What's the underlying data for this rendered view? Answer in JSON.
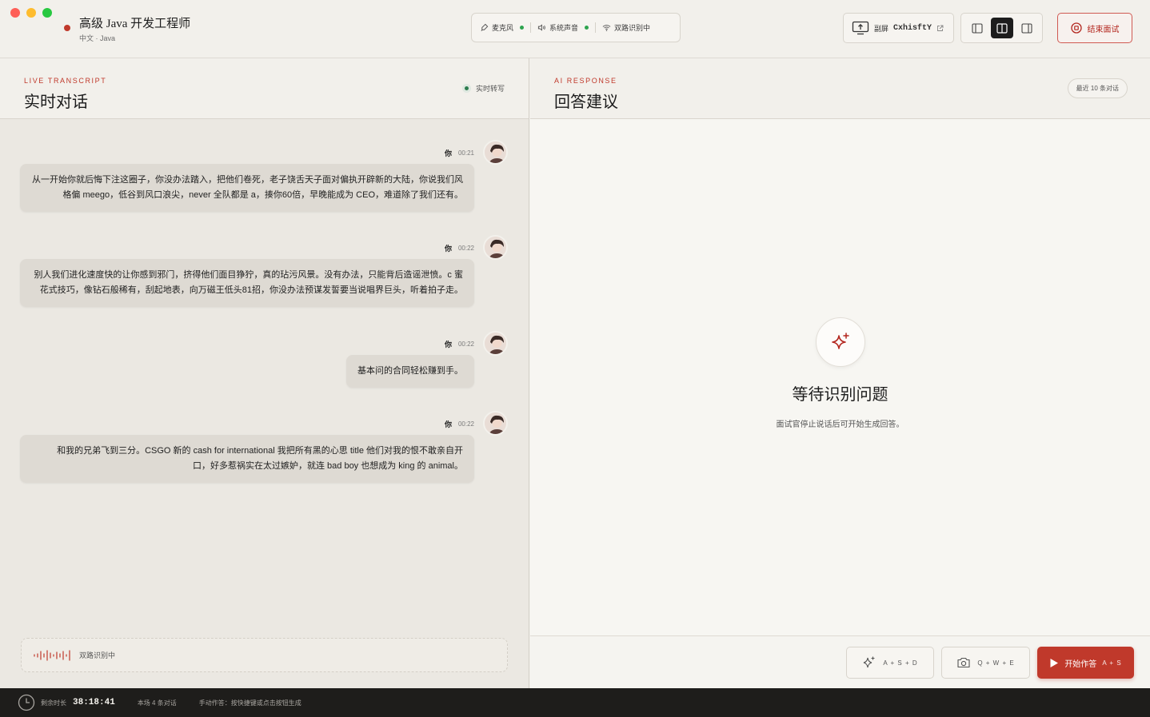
{
  "window": {
    "job_title": "高级 Java 开发工程师",
    "job_sub": "中文 · Java"
  },
  "status": {
    "mic": "麦克风",
    "system_audio": "系统声音",
    "dual": "双路识别中"
  },
  "toolbar": {
    "screen_label": "副屏",
    "screen_code": "CxhisftY",
    "end_label": "结束面试"
  },
  "left": {
    "eyebrow": "LIVE TRANSCRIPT",
    "title": "实时对话",
    "live_label": "实时转写",
    "messages": [
      {
        "speaker": "你",
        "time": "00:21",
        "lines": [
          "从一开始你就后悔下注这圈子，你没办法踏入，把他们卷死，老子饶舌天子面对偏执开辟新的大陆，你说我们风",
          "格偏 meego，低谷到风口浪尖，never 全队都是 a，揍你60倍，早晚能成为 CEO，难道除了我们还有。"
        ]
      },
      {
        "speaker": "你",
        "time": "00:22",
        "lines": [
          "别人我们进化速度快的让你感到邪门，挤得他们面目狰狞，真的玷污风景。没有办法，只能背后造谣泄愤。c 蜜",
          "花式技巧，像钻石般稀有，刮起地表，向万磁王低头81招，你没办法预谋发誓要当说唱界巨头，听着拍子走。"
        ]
      },
      {
        "speaker": "你",
        "time": "00:22",
        "lines": [
          "基本问的合同轻松赚到手。"
        ]
      },
      {
        "speaker": "你",
        "time": "00:22",
        "lines": [
          "和我的兄弟飞到三分。CSGO 新的 cash for international 我把所有黑的心思 title 他们对我的恨不敢亲自开",
          "口，好多惹祸实在太过嫉妒，就连 bad boy 也想成为 king 的 animal。"
        ]
      }
    ],
    "recog_label": "双路识别中"
  },
  "right": {
    "eyebrow": "AI RESPONSE",
    "title": "回答建议",
    "recent": "最近 10 条对话",
    "wait_title": "等待识别问题",
    "wait_sub": "面试官停止说话后可开始生成回答。",
    "btn_ai_keys": "A + S + D",
    "btn_shot_keys": "Q + W + E",
    "btn_go_label": "开始作答",
    "btn_go_keys": "A + S"
  },
  "statusbar": {
    "remain_label": "剩余时长",
    "timer": "38:18:41",
    "count": "本场 4 条对话",
    "hint": "手动作答：按快捷键或点击按钮生成"
  },
  "colors": {
    "accent": "#c0392b",
    "live_green": "#2ea44f"
  }
}
